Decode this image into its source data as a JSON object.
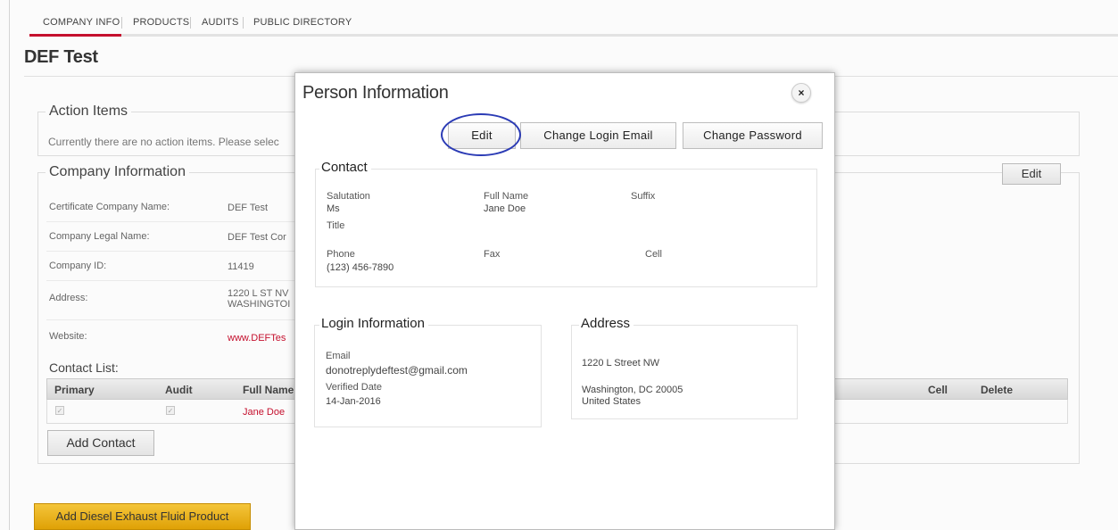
{
  "tabs": [
    "COMPANY INFO",
    "PRODUCTS",
    "AUDITS",
    "PUBLIC DIRECTORY"
  ],
  "page_title": "DEF Test",
  "action_items": {
    "legend": "Action Items",
    "message": "Currently there are no action items. Please selec"
  },
  "company_info": {
    "legend": "Company Information",
    "edit_label": "Edit",
    "fields": [
      {
        "label": "Certificate Company Name:",
        "value": "DEF Test"
      },
      {
        "label": "Company Legal Name:",
        "value": "DEF Test Cor"
      },
      {
        "label": "Company ID:",
        "value": "11419"
      },
      {
        "label": "Address:",
        "value": "1220 L ST NV",
        "value2": "WASHINGTOI"
      },
      {
        "label": "Website:",
        "value": "www.DEFTes"
      }
    ]
  },
  "contact_list": {
    "label": "Contact List:",
    "columns": [
      "Primary",
      "Audit",
      "Full Name",
      "Cell",
      "Delete"
    ],
    "row_name": "Jane Doe",
    "add_label": "Add Contact"
  },
  "add_product_label": "Add Diesel Exhaust Fluid Product",
  "modal": {
    "title": "Person Information",
    "close_glyph": "×",
    "buttons": {
      "edit": "Edit",
      "change_email": "Change Login Email",
      "change_password": "Change Password"
    },
    "contact": {
      "legend": "Contact",
      "salutation_label": "Salutation",
      "salutation": "Ms",
      "title_label": "Title",
      "full_name_label": "Full Name",
      "full_name": "Jane Doe",
      "suffix_label": "Suffix",
      "phone_label": "Phone",
      "phone": "(123) 456-7890",
      "fax_label": "Fax",
      "cell_label": "Cell"
    },
    "login": {
      "legend": "Login Information",
      "email_label": "Email",
      "email": "donotreplydeftest@gmail.com",
      "verified_label": "Verified Date",
      "verified": "14-Jan-2016"
    },
    "address": {
      "legend": "Address",
      "line1": "1220 L Street NW",
      "line2": "Washington, DC 20005",
      "line3": "United States"
    }
  },
  "colors": {
    "accent": "#c8102e",
    "gold": "#f0b81c",
    "highlight": "#2b3bb5"
  }
}
